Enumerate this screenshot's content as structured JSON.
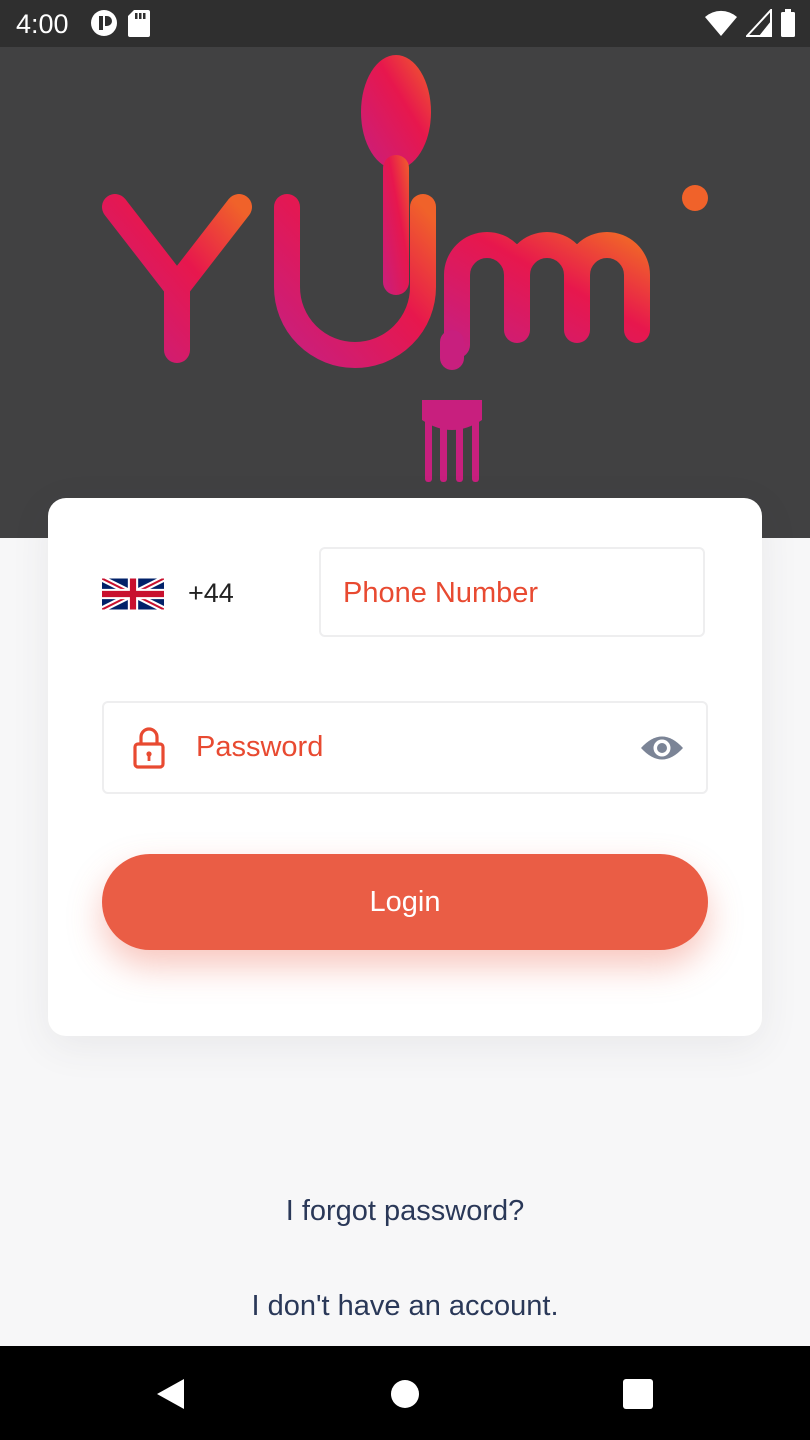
{
  "status_bar": {
    "time": "4:00",
    "left_icons": [
      "notification-icon",
      "sd-card-icon"
    ],
    "right_icons": [
      "wifi-icon",
      "signal-icon",
      "battery-icon"
    ]
  },
  "logo": {
    "text": "YUMi",
    "icons": [
      "spoon-icon",
      "fork-icon"
    ]
  },
  "login_form": {
    "country_code": "+44",
    "country_flag": "uk-flag-icon",
    "phone_placeholder": "Phone Number",
    "password_placeholder": "Password",
    "login_label": "Login"
  },
  "links": {
    "forgot_password": "I forgot password?",
    "no_account": "I don't have an account."
  },
  "nav_bar": {
    "buttons": [
      "back-icon",
      "home-icon",
      "recent-apps-icon"
    ]
  },
  "colors": {
    "accent": "#ea5d45",
    "placeholder": "#e84a31",
    "link_text": "#2a3858",
    "header_bg": "#414142",
    "logo_gradient_start": "#c81f7e",
    "logo_gradient_end": "#f0622a"
  }
}
